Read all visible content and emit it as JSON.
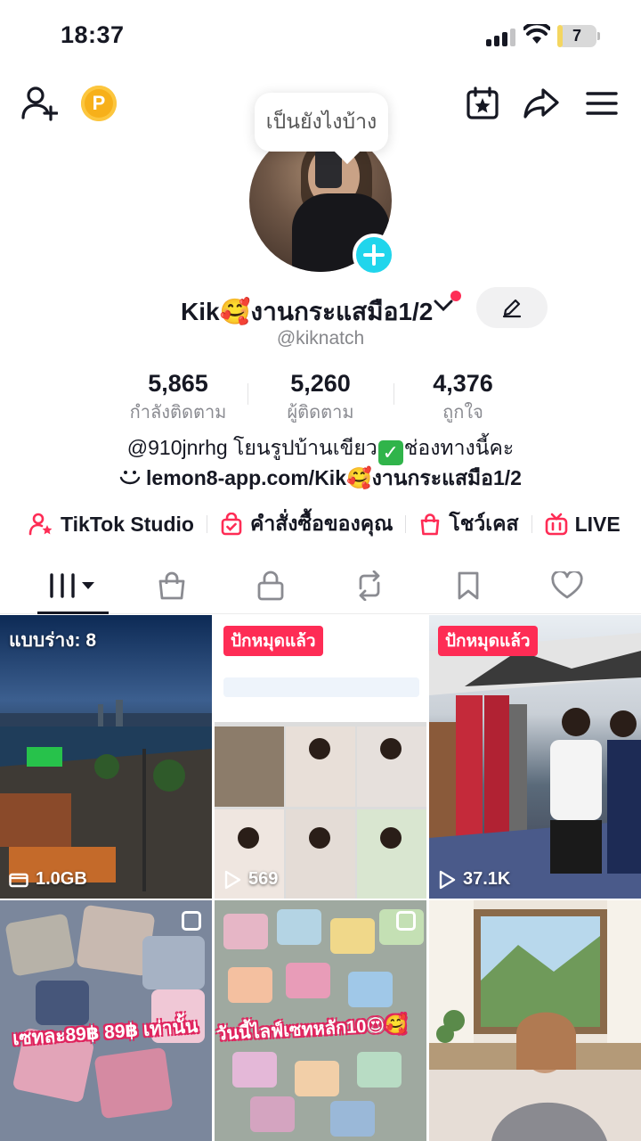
{
  "status_bar": {
    "time": "18:37",
    "battery": "7",
    "battery_level": 0.07
  },
  "top_bar": {
    "add_friend_icon": "person-plus-icon",
    "coin_label": "P",
    "calendar_icon": "calendar-star-icon",
    "share_icon": "share-arrow-icon",
    "menu_icon": "hamburger-menu-icon"
  },
  "profile": {
    "bubble_text": "เป็นยังไงบ้าง",
    "name": "Kik🥰งานกระแสมือ1/2",
    "handle": "@kiknatch",
    "stats": [
      {
        "value": "5,865",
        "label": "กำลังติดตาม"
      },
      {
        "value": "5,260",
        "label": "ผู้ติดตาม"
      },
      {
        "value": "4,376",
        "label": "ถูกใจ"
      }
    ],
    "bio_before": "@910jnrhg โยนรูปบ้านเขียว",
    "bio_check": "✓",
    "bio_after": "ช่องทางนี้คะ",
    "link": "lemon8-app.com/Kik🥰งานกระแสมือ1/2"
  },
  "quick_links": [
    {
      "label": "TikTok Studio",
      "icon": "person-star-icon"
    },
    {
      "label": "คำสั่งซื้อของคุณ",
      "icon": "bag-check-icon"
    },
    {
      "label": "โชว์เคส",
      "icon": "shopping-bag-icon"
    },
    {
      "label": "LIVE",
      "icon": "tv-live-icon"
    }
  ],
  "tabs": [
    {
      "name": "videos",
      "icon": "grid-icon",
      "active": true
    },
    {
      "name": "shop",
      "icon": "shopping-bag-icon"
    },
    {
      "name": "private",
      "icon": "lock-icon"
    },
    {
      "name": "reposts",
      "icon": "repost-icon"
    },
    {
      "name": "favorites",
      "icon": "bookmark-icon"
    },
    {
      "name": "liked",
      "icon": "heart-icon"
    }
  ],
  "grid": [
    {
      "overlay": "แบบร่าง: 8",
      "footer": "1.0GB",
      "footer_icon": "folder-icon"
    },
    {
      "badge": "ปักหมุดแล้ว",
      "views": "569",
      "views_icon": "play-icon"
    },
    {
      "badge": "ปักหมุดแล้ว",
      "views": "37.1K",
      "views_icon": "play-icon"
    },
    {
      "caption": "เซทละ89฿ 89฿ เท่านั้น",
      "multi_icon": "photo-stack-icon"
    },
    {
      "caption": "วันนี้ไลฟ์เซทหลัก10😍🥰",
      "multi_icon": "photo-stack-icon"
    },
    {}
  ],
  "colors": {
    "accent": "#fe2c55",
    "avatar_plus": "#20d5ec",
    "text": "#161823",
    "muted": "#86878b"
  }
}
